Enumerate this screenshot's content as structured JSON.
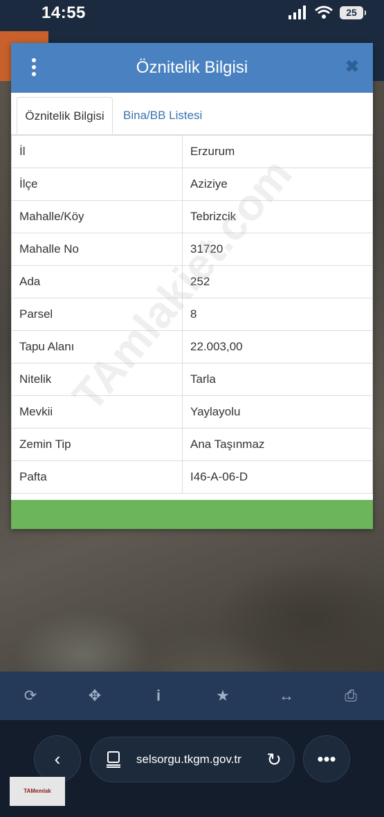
{
  "status": {
    "time": "14:55",
    "battery": "25"
  },
  "dialog": {
    "title": "Öznitelik Bilgisi",
    "tabs": [
      {
        "label": "Öznitelik Bilgisi",
        "active": true
      },
      {
        "label": "Bina/BB Listesi",
        "active": false
      }
    ],
    "rows": [
      {
        "key": "İl",
        "value": "Erzurum"
      },
      {
        "key": "İlçe",
        "value": "Aziziye"
      },
      {
        "key": "Mahalle/Köy",
        "value": "Tebrizcik"
      },
      {
        "key": "Mahalle No",
        "value": "31720"
      },
      {
        "key": "Ada",
        "value": "252"
      },
      {
        "key": "Parsel",
        "value": "8"
      },
      {
        "key": "Tapu Alanı",
        "value": "22.003,00"
      },
      {
        "key": "Nitelik",
        "value": "Tarla"
      },
      {
        "key": "Mevkii",
        "value": "Yaylayolu"
      },
      {
        "key": "Zemin Tip",
        "value": "Ana Taşınmaz"
      },
      {
        "key": "Pafta",
        "value": "I46-A-06-D"
      }
    ],
    "accent_color": "#4a82c1",
    "footer_color": "#6cb55a"
  },
  "watermark": "TAmlakiet.com",
  "toolbar": {
    "icons": [
      "refresh-icon",
      "crosshair-icon",
      "info-icon",
      "star-icon",
      "arrows-horizontal-icon",
      "print-icon"
    ]
  },
  "browser": {
    "url": "selsorgu.tkgm.gov.tr",
    "logo_text": "TAMemlak"
  }
}
